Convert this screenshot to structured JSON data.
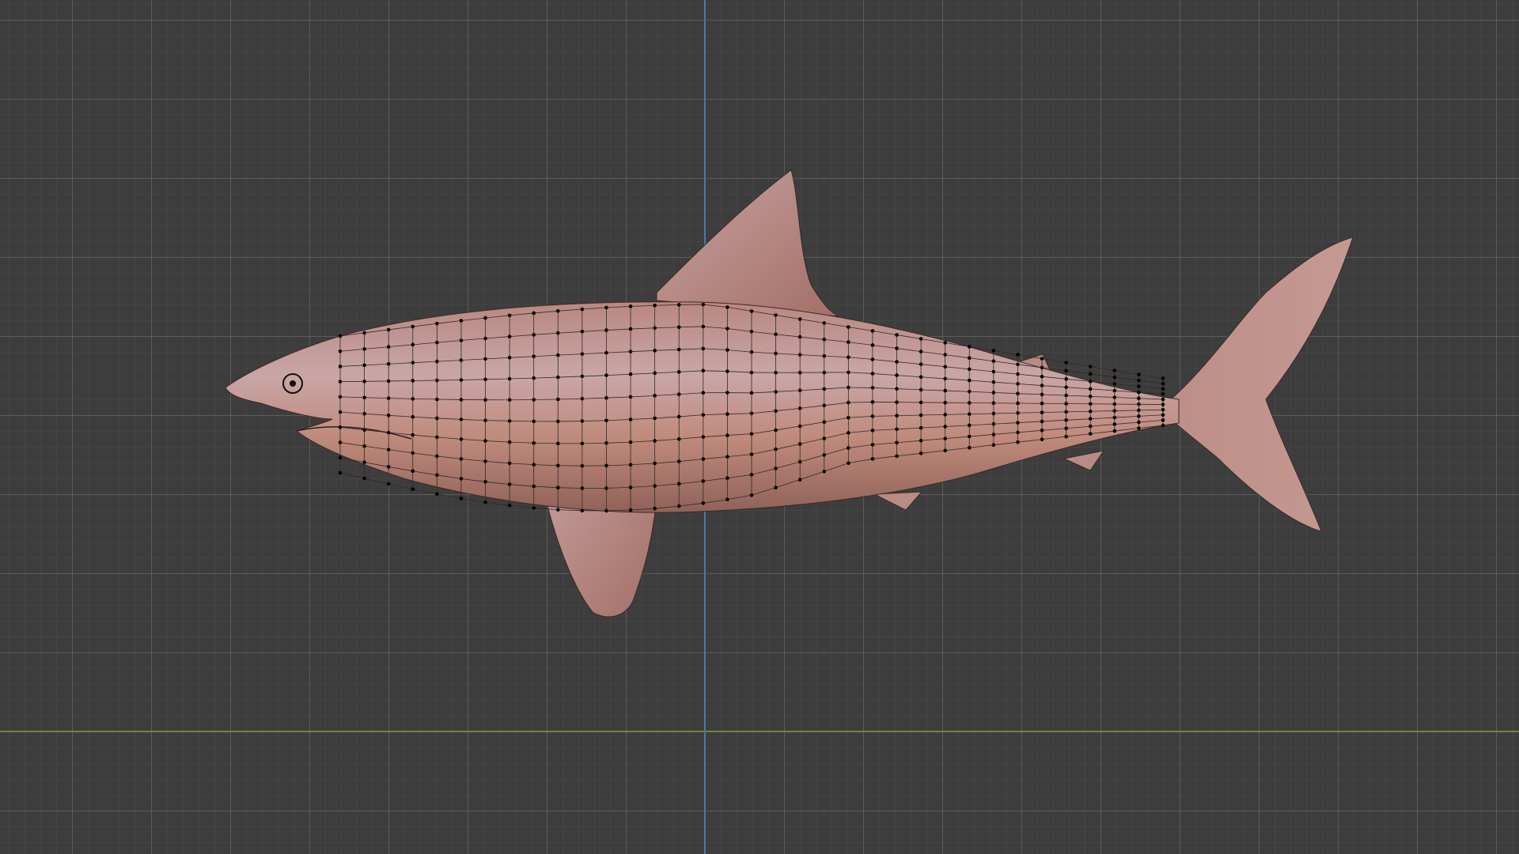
{
  "viewport": {
    "background_color": "#3d3d3d",
    "grid_color": "#5a5a5a",
    "axis_x_color": "#6a8a3a",
    "axis_y_color": "#4a7aa6"
  },
  "object": {
    "type": "shark-mesh",
    "mode": "edit-mode-vertex",
    "surface_color": "#c08a80",
    "vertex_color": "#000000"
  }
}
